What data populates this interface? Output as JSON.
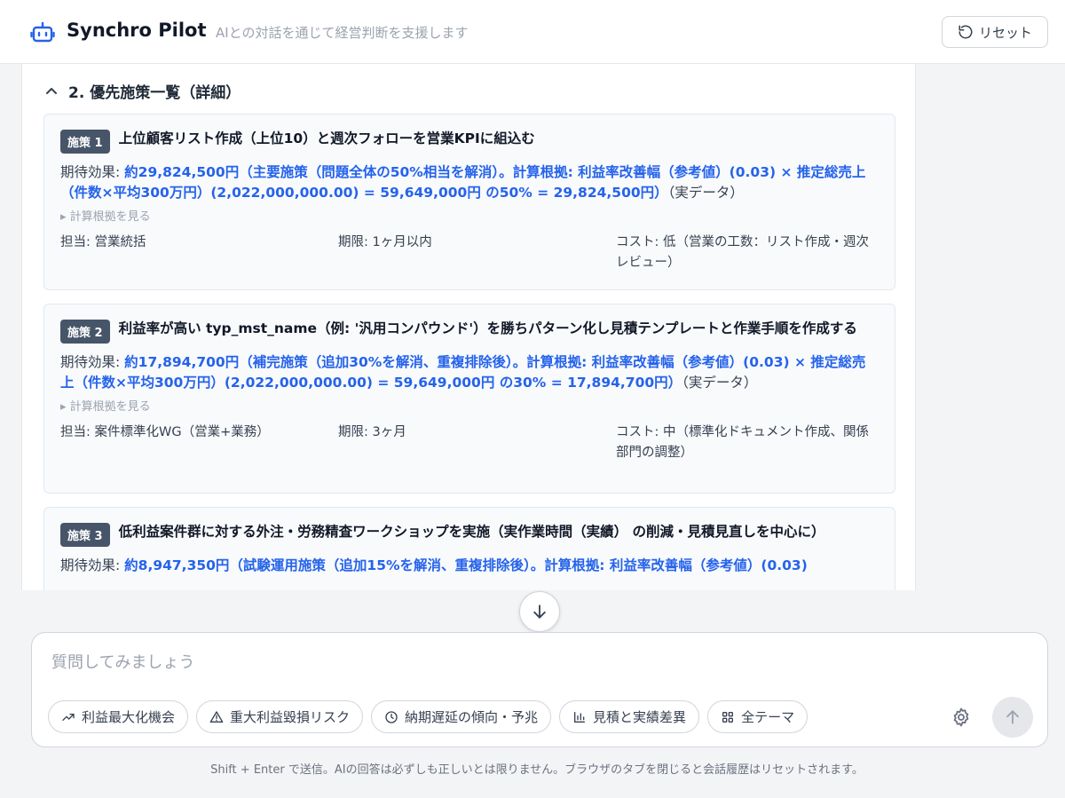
{
  "header": {
    "title": "Synchro Pilot",
    "subtitle": "AIとの対話を通じて経営判断を支援します",
    "reset_label": "リセット"
  },
  "section": {
    "title": "2. 優先施策一覧（詳細）"
  },
  "cards": [
    {
      "badge": "施策 1",
      "title": "上位顧客リスト作成（上位10）と週次フォローを営業KPIに組込む",
      "effect_label": "期待効果: ",
      "effect_value": "約29,824,500円（主要施策（問題全体の50%相当を解消）。計算根拠: 利益率改善幅（参考値）(0.03) × 推定総売上（件数×平均300万円）(2,022,000,000.00) = 59,649,000円 の50% = 29,824,500円）",
      "effect_tail": "（実データ）",
      "calc_link": "▸ 計算根拠を見る",
      "owner": "担当: 営業統括",
      "due": "期限: 1ヶ月以内",
      "cost": "コスト: 低（営業の工数：リスト作成・週次レビュー）"
    },
    {
      "badge": "施策 2",
      "title": "利益率が高い typ_mst_name（例: '汎用コンパウンド'）を勝ちパターン化し見積テンプレートと作業手順を作成する",
      "effect_label": "期待効果: ",
      "effect_value": "約17,894,700円（補完施策（追加30%を解消、重複排除後）。計算根拠: 利益率改善幅（参考値）(0.03) × 推定総売上（件数×平均300万円）(2,022,000,000.00) = 59,649,000円 の30% = 17,894,700円）",
      "effect_tail": "（実データ）",
      "calc_link": "▸ 計算根拠を見る",
      "owner": "担当: 案件標準化WG（営業+業務）",
      "due": "期限: 3ヶ月",
      "cost": "コスト: 中（標準化ドキュメント作成、関係部門の調整）"
    },
    {
      "badge": "施策 3",
      "title": "低利益案件群に対する外注・労務精査ワークショップを実施（実作業時間（実績） の削減・見積見直しを中心に）",
      "effect_label": "期待効果: ",
      "effect_value": "約8,947,350円（試験運用施策（追加15%を解消、重複排除後）。計算根拠: 利益率改善幅（参考値）(0.03)",
      "effect_tail": "",
      "calc_link": "",
      "owner": "",
      "due": "",
      "cost": ""
    }
  ],
  "chat": {
    "placeholder": "質問してみましょう",
    "chips": [
      {
        "label": "利益最大化機会",
        "icon": "trending-up-icon"
      },
      {
        "label": "重大利益毀損リスク",
        "icon": "warning-icon"
      },
      {
        "label": "納期遅延の傾向・予兆",
        "icon": "clock-icon"
      },
      {
        "label": "見積と実績差異",
        "icon": "bar-chart-icon"
      },
      {
        "label": "全テーマ",
        "icon": "grid-icon"
      }
    ]
  },
  "footer": {
    "note": "Shift + Enter で送信。AIの回答は必ずしも正しいとは限りません。ブラウザのタブを閉じると会話履歴はリセットされます。"
  },
  "colors": {
    "accent_blue": "#2563eb",
    "badge_bg": "#475569"
  }
}
